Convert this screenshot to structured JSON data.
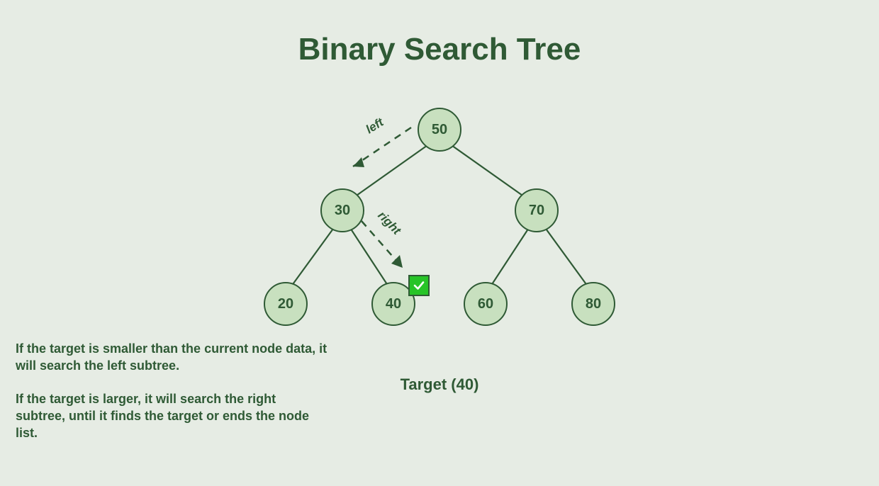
{
  "title": "Binary Search Tree",
  "target_label": "Target (40)",
  "edge_labels": {
    "left": "left",
    "right": "right"
  },
  "nodes": {
    "n50": "50",
    "n30": "30",
    "n70": "70",
    "n20": "20",
    "n40": "40",
    "n60": "60",
    "n80": "80"
  },
  "found_node": "40",
  "explain_p1": "If the target is smaller than the current node data, it will search the left subtree.",
  "explain_p2": "If the target is larger, it will search the right subtree, until it finds the target or ends the node list.",
  "chart_data": {
    "type": "tree",
    "tree": {
      "value": 50,
      "left": {
        "value": 30,
        "left": {
          "value": 20
        },
        "right": {
          "value": 40
        }
      },
      "right": {
        "value": 70,
        "left": {
          "value": 60
        },
        "right": {
          "value": 80
        }
      }
    },
    "target": 40,
    "search_path": [
      {
        "from": 50,
        "direction": "left",
        "to": 30
      },
      {
        "from": 30,
        "direction": "right",
        "to": 40
      }
    ],
    "found": true
  }
}
